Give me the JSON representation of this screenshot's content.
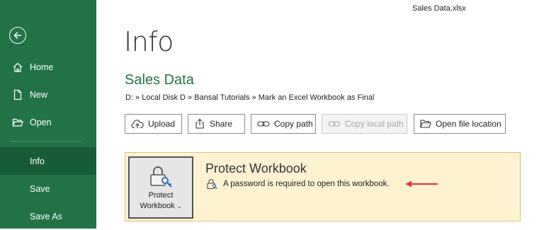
{
  "window": {
    "filename": "Sales Data.xlsx"
  },
  "sidebar": {
    "back_icon": "back-arrow-icon",
    "items": [
      {
        "label": "Home",
        "icon": "home-icon"
      },
      {
        "label": "New",
        "icon": "new-document-icon"
      },
      {
        "label": "Open",
        "icon": "open-folder-icon"
      },
      {
        "label": "Info",
        "icon": "",
        "active": true
      },
      {
        "label": "Save",
        "icon": ""
      },
      {
        "label": "Save As",
        "icon": ""
      }
    ]
  },
  "main": {
    "title": "Info",
    "doc_title": "Sales Data",
    "path": "D: » Local Disk D » Bansal Tutorials » Mark an Excel Workbook as Final",
    "actions": [
      {
        "label": "Upload",
        "icon": "upload-icon",
        "enabled": true
      },
      {
        "label": "Share",
        "icon": "share-icon",
        "enabled": true
      },
      {
        "label": "Copy path",
        "icon": "link-icon",
        "enabled": true
      },
      {
        "label": "Copy local path",
        "icon": "link-icon",
        "enabled": false
      },
      {
        "label": "Open file location",
        "icon": "folder-icon",
        "enabled": true
      }
    ],
    "protect": {
      "button_line1": "Protect",
      "button_line2": "Workbook",
      "title": "Protect Workbook",
      "description": "A password is required to open this workbook.",
      "icon": "lock-key-icon",
      "arrow_color": "#e03a3a"
    }
  },
  "colors": {
    "accent": "#217346",
    "sidebar_active": "#185c37",
    "panel_bg": "#fdf3d1"
  }
}
